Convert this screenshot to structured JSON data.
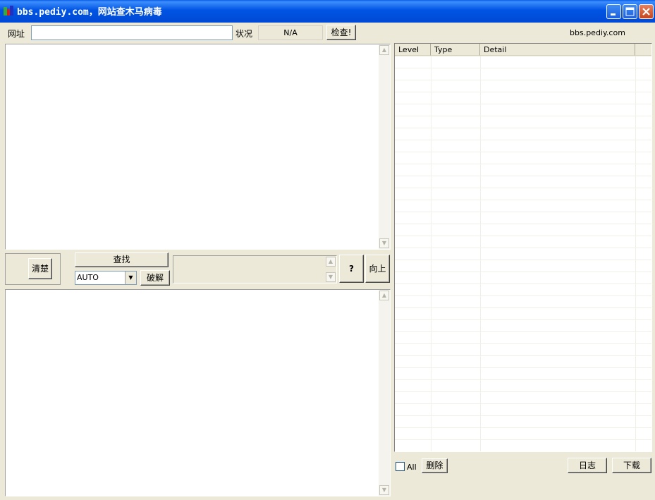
{
  "window": {
    "title": "bbs.pediy.com，网站查木马病毒",
    "minimize_icon": "minimize-icon",
    "maximize_icon": "maximize-icon",
    "close_icon": "close-icon"
  },
  "toolbar": {
    "url_label": "网址",
    "url_value": "",
    "status_label": "状况",
    "status_value": "N/A",
    "check_button": "检查!",
    "site_link": "bbs.pediy.com"
  },
  "middle": {
    "clear_button": "清楚",
    "find_button": "查找",
    "encoding_select": "AUTO",
    "crack_button": "破解",
    "help_button": "?",
    "up_button": "向上"
  },
  "results": {
    "columns": [
      "Level",
      "Type",
      "Detail"
    ],
    "rows": []
  },
  "bottom": {
    "all_checkbox_label": "All",
    "all_checked": false,
    "delete_button": "删除",
    "log_button": "日志",
    "download_button": "下载"
  },
  "colors": {
    "titlebar": "#0054e3",
    "window_bg": "#ece9d8",
    "close_button": "#c4461c"
  }
}
